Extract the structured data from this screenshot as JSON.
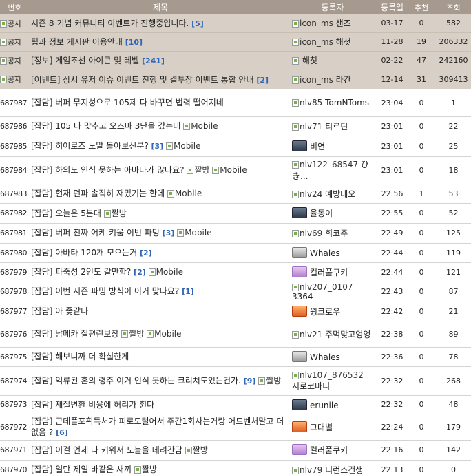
{
  "header": {
    "no": "번호",
    "title": "제목",
    "author": "등록자",
    "date": "등록일",
    "recommend": "추천",
    "views": "조회"
  },
  "notices": [
    {
      "no": "공지",
      "title": "시즌 8 기념 커뮤니티 이벤트가 진행중입니다.",
      "comments": "[5]",
      "user_alt": "icon_ms",
      "user": "샌즈",
      "date": "03-17",
      "rec": "0",
      "views": "582"
    },
    {
      "no": "공지",
      "title": "팁과 정보 게시판 이용안내",
      "comments": "[10]",
      "user_alt": "icon_ms",
      "user": "해첫",
      "date": "11-28",
      "rec": "19",
      "views": "206332"
    },
    {
      "no": "공지",
      "title": "[정보] 게임조선 아이콘 및 레벨",
      "comments": "[241]",
      "user_alt": "",
      "user": "해첫",
      "date": "02-22",
      "rec": "47",
      "views": "242160"
    },
    {
      "no": "공지",
      "title": "[이벤트] 상시 유저 이슈 이벤트 진행 및 결투장 이벤트 통합 안내",
      "comments": "[2]",
      "user_alt": "icon_ms",
      "user": "라칸",
      "date": "12-14",
      "rec": "31",
      "views": "309413"
    }
  ],
  "posts": [
    {
      "no": "687987",
      "title": "[잡담] 버퍼 무지성으로 105제 다 바꾸면 법력 떨어지네",
      "comments": "",
      "tags": [],
      "lv": "nlv85",
      "user": "TomNToms",
      "date": "23:04",
      "rec": "0",
      "views": "1"
    },
    {
      "no": "687986",
      "title": "[잡담] 105 다 맞추고 오즈마 3단을 갔는데",
      "comments": "",
      "tags": [
        "Mobile"
      ],
      "lv": "nlv71",
      "user": "티르틴",
      "date": "23:01",
      "rec": "0",
      "views": "22"
    },
    {
      "no": "687985",
      "title": "[잡담] 히어로즈 노말 돌아보신분?",
      "comments": "[3]",
      "tags": [
        "Mobile"
      ],
      "lv": "",
      "user": "비연",
      "date": "23:01",
      "rec": "0",
      "views": "25"
    },
    {
      "no": "687984",
      "title": "[잡담] 하의도 인식 못하는 아바타가 많나요?",
      "comments": "",
      "tags": [
        "짤방",
        "Mobile"
      ],
      "lv": "nlv122_68547",
      "user": "ひき...",
      "date": "23:01",
      "rec": "0",
      "views": "18"
    },
    {
      "no": "687983",
      "title": "[잡담] 현재 던파 솔직히 재밌기는 한데",
      "comments": "",
      "tags": [
        "Mobile"
      ],
      "lv": "nlv24",
      "user": "예방데오",
      "date": "22:56",
      "rec": "1",
      "views": "53"
    },
    {
      "no": "687982",
      "title": "[잡담] 오늘은 5분대",
      "comments": "",
      "tags": [
        "짤방"
      ],
      "lv": "",
      "user": "율동이",
      "date": "22:55",
      "rec": "0",
      "views": "52"
    },
    {
      "no": "687981",
      "title": "[잡담] 버퍼 진짜 어케 키움 이번 파밍",
      "comments": "[3]",
      "tags": [
        "Mobile"
      ],
      "lv": "nlv69",
      "user": "희코주",
      "date": "22:49",
      "rec": "0",
      "views": "125"
    },
    {
      "no": "687980",
      "title": "[잡담] 아바타 120개 모으는거",
      "comments": "[2]",
      "tags": [],
      "lv": "",
      "user": "Whales",
      "date": "22:44",
      "rec": "0",
      "views": "119"
    },
    {
      "no": "687979",
      "title": "[잡담] 파죽성 2인도 갈만함?",
      "comments": "[2]",
      "tags": [
        "Mobile"
      ],
      "lv": "",
      "user": "컬러풀쿠키",
      "date": "22:44",
      "rec": "0",
      "views": "121"
    },
    {
      "no": "687978",
      "title": "[잡담] 이번 시즌 파밍 방식이 이거 맞나요?",
      "comments": "[1]",
      "tags": [],
      "lv": "nlv207_0107",
      "user": "3364",
      "date": "22:43",
      "rec": "0",
      "views": "87"
    },
    {
      "no": "687977",
      "title": "[잡담] 아 좆같다",
      "comments": "",
      "tags": [],
      "lv": "",
      "user": "윙크로우",
      "date": "22:42",
      "rec": "0",
      "views": "21"
    },
    {
      "no": "687976",
      "title": "[잡담] 남메카 질편린보장",
      "comments": "",
      "tags": [
        "짤방",
        "Mobile"
      ],
      "lv": "nlv21",
      "user": "주먹맞고엉엉",
      "date": "22:38",
      "rec": "0",
      "views": "89"
    },
    {
      "no": "687975",
      "title": "[잡담] 해보니까 더 확실한게",
      "comments": "",
      "tags": [],
      "lv": "",
      "user": "Whales",
      "date": "22:36",
      "rec": "0",
      "views": "78"
    },
    {
      "no": "687974",
      "title": "[잡담] 억류된 혼의 령주 이거 인식 못하는 크리쳐도있는건가.",
      "comments": "[9]",
      "tags": [
        "짤방"
      ],
      "lv": "nlv107_876532",
      "user": "시로코마디",
      "date": "22:32",
      "rec": "0",
      "views": "268"
    },
    {
      "no": "687973",
      "title": "[잡담] 재질변환 비용에 허리가 휜다",
      "comments": "",
      "tags": [],
      "lv": "",
      "user": "erunile",
      "date": "22:32",
      "rec": "0",
      "views": "48"
    },
    {
      "no": "687972",
      "title": "[잡담] 근데플포획득처가 피로도털어서 주간1회사는거랑 어드벤처말고 더없음 ?",
      "comments": "[6]",
      "tags": [],
      "lv": "",
      "user": "그대별",
      "date": "22:24",
      "rec": "0",
      "views": "179"
    },
    {
      "no": "687971",
      "title": "[잡담] 이걸 언제 다 키워서 노블을 데려간담",
      "comments": "",
      "tags": [
        "짤방"
      ],
      "lv": "",
      "user": "컬러풀쿠키",
      "date": "22:16",
      "rec": "0",
      "views": "142"
    },
    {
      "no": "687970",
      "title": "[잡담] 일단 제일 바같은 새끼",
      "comments": "",
      "tags": [
        "짤방"
      ],
      "lv": "nlv79",
      "user": "디런스건생",
      "date": "22:13",
      "rec": "0",
      "views": "0"
    }
  ]
}
